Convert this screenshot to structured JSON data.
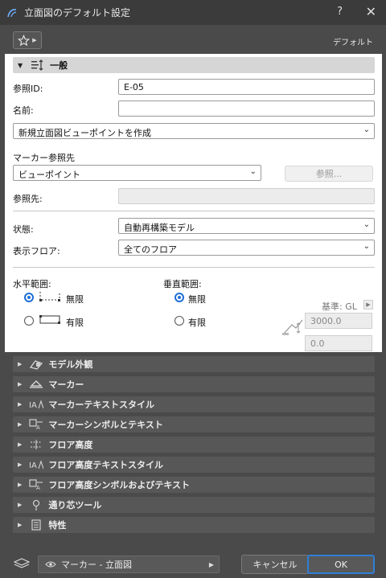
{
  "window": {
    "title": "立面図のデフォルト設定",
    "help": "?",
    "close": "✕"
  },
  "favorites": {
    "default_label": "デフォルト"
  },
  "general": {
    "header": "一般",
    "ref_id_label": "参照ID:",
    "ref_id_value": "E-05",
    "name_label": "名前:",
    "name_value": "",
    "viewpoint_select": "新規立面図ビューポイントを作成",
    "marker_ref_label": "マーカー参照先",
    "marker_ref_select": "ビューポイント",
    "browse_button": "参照...",
    "ref_target_label": "参照先:",
    "status_label": "状態:",
    "status_value": "自動再構築モデル",
    "display_floor_label": "表示フロア:",
    "display_floor_value": "全てのフロア",
    "horizontal_range_label": "水平範囲:",
    "h_unlimited": "無限",
    "h_limited": "有限",
    "vertical_range_label": "垂直範囲:",
    "v_unlimited": "無限",
    "v_limited": "有限",
    "base_label": "基準: GL",
    "upper_value": "3000.0",
    "lower_value": "0.0"
  },
  "sections": [
    {
      "label": "モデル外観",
      "icon": "model-appearance-icon"
    },
    {
      "label": "マーカー",
      "icon": "marker-icon"
    },
    {
      "label": "マーカーテキストスタイル",
      "icon": "marker-text-style-icon"
    },
    {
      "label": "マーカーシンボルとテキスト",
      "icon": "marker-symbol-icon"
    },
    {
      "label": "フロア高度",
      "icon": "floor-level-icon"
    },
    {
      "label": "フロア高度テキストスタイル",
      "icon": "floor-level-text-icon"
    },
    {
      "label": "フロア高度シンボルおよびテキスト",
      "icon": "floor-level-symbol-icon"
    },
    {
      "label": "通り芯ツール",
      "icon": "grid-tool-icon"
    },
    {
      "label": "特性",
      "icon": "properties-icon"
    }
  ],
  "footer": {
    "layer": "マーカー - 立面図",
    "cancel": "キャンセル",
    "ok": "OK"
  }
}
